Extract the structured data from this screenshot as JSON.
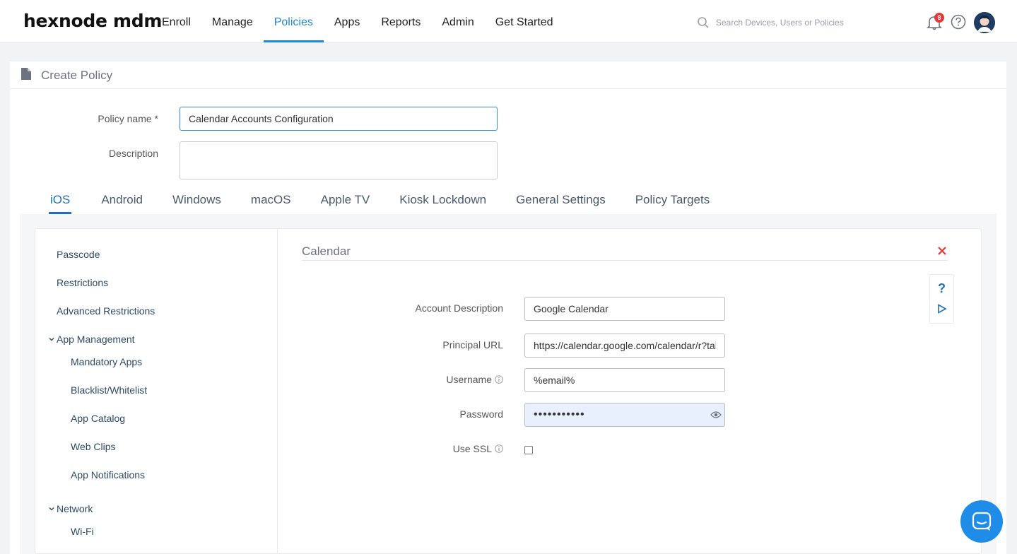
{
  "brand": {
    "logo": "hexnode mdm"
  },
  "nav": {
    "items": [
      {
        "label": "Enroll",
        "active": false
      },
      {
        "label": "Manage",
        "active": false
      },
      {
        "label": "Policies",
        "active": true
      },
      {
        "label": "Apps",
        "active": false
      },
      {
        "label": "Reports",
        "active": false
      },
      {
        "label": "Admin",
        "active": false
      },
      {
        "label": "Get Started",
        "active": false
      }
    ]
  },
  "search": {
    "placeholder": "Search Devices, Users or Policies"
  },
  "notifications": {
    "count": "8"
  },
  "page": {
    "title": "Create Policy"
  },
  "form": {
    "policy_name_label": "Policy name *",
    "policy_name_value": "Calendar Accounts Configuration",
    "description_label": "Description",
    "description_value": ""
  },
  "platform_tabs": [
    {
      "label": "iOS",
      "active": true
    },
    {
      "label": "Android"
    },
    {
      "label": "Windows"
    },
    {
      "label": "macOS"
    },
    {
      "label": "Apple TV"
    },
    {
      "label": "Kiosk Lockdown"
    },
    {
      "label": "General Settings"
    },
    {
      "label": "Policy Targets"
    }
  ],
  "sidebar": {
    "passcode": "Passcode",
    "restrictions": "Restrictions",
    "advanced_restrictions": "Advanced Restrictions",
    "app_management": "App Management",
    "mandatory_apps": "Mandatory Apps",
    "blacklist_whitelist": "Blacklist/Whitelist",
    "app_catalog": "App Catalog",
    "web_clips": "Web Clips",
    "app_notifications": "App Notifications",
    "network": "Network",
    "wifi": "Wi-Fi"
  },
  "section": {
    "title": "Calendar",
    "help_label": "?",
    "fields": {
      "account_description_label": "Account Description",
      "account_description_value": "Google Calendar",
      "principal_url_label": "Principal URL",
      "principal_url_value": "https://calendar.google.com/calendar/r?tab=mc",
      "username_label": "Username",
      "username_value": "%email%",
      "password_label": "Password",
      "password_value": "•••••••••••",
      "use_ssl_label": "Use SSL",
      "use_ssl_checked": false
    }
  },
  "colors": {
    "accent": "#1e88d9",
    "close": "#e53935",
    "chat": "#1f8de8"
  }
}
